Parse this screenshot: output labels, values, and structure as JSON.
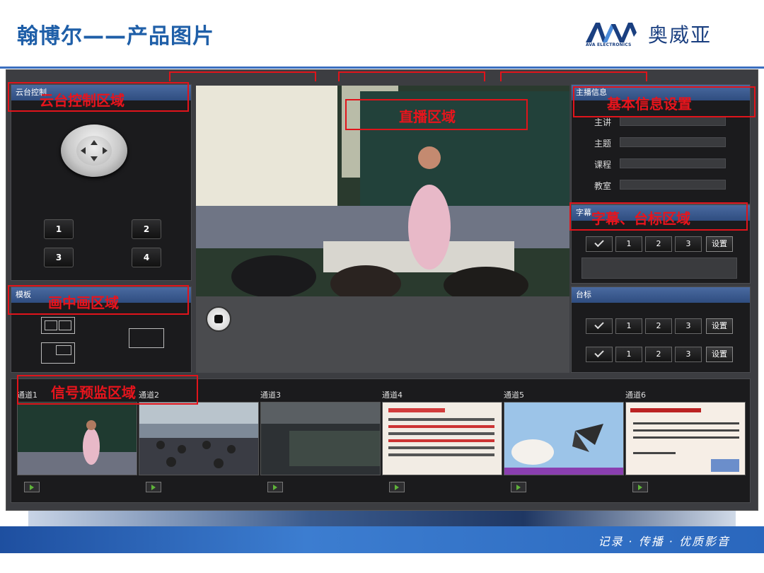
{
  "slide": {
    "title": "翰博尔——产品图片",
    "logo_text": "奥威亚",
    "logo_mark": "AVA",
    "logo_sub": "AVA ELECTRONICS",
    "slogan": "记录 · 传播 · 优质影音"
  },
  "ptz": {
    "header": "云台控制",
    "presets": [
      "1",
      "2",
      "3",
      "4"
    ]
  },
  "template": {
    "header": "模板"
  },
  "info": {
    "header": "主播信息",
    "fields": [
      {
        "label": "主讲",
        "value": ""
      },
      {
        "label": "主题",
        "value": ""
      },
      {
        "label": "课程",
        "value": ""
      },
      {
        "label": "教室",
        "value": ""
      }
    ]
  },
  "subtitle": {
    "header": "字幕",
    "buttons": [
      "1",
      "2",
      "3"
    ],
    "settings_label": "设置"
  },
  "station_logo": {
    "header": "台标",
    "buttons": [
      "1",
      "2",
      "3"
    ],
    "settings_label": "设置"
  },
  "preview": {
    "channels": [
      "通道1",
      "通道2",
      "通道3",
      "通道4",
      "通道5",
      "通道6"
    ]
  },
  "annotations": {
    "ptz_area": "云台控制区域",
    "live_area": "直播区域",
    "info_area": "基本信息设置",
    "subtitle_area": "字幕、台标区域",
    "pip_area": "画中画区域",
    "preview_area": "信号预监区域"
  },
  "colors": {
    "title": "#1f5fa8",
    "annotation": "#e0141b",
    "panel_header": "#3b5d93",
    "app_bg": "#3c3d41"
  }
}
